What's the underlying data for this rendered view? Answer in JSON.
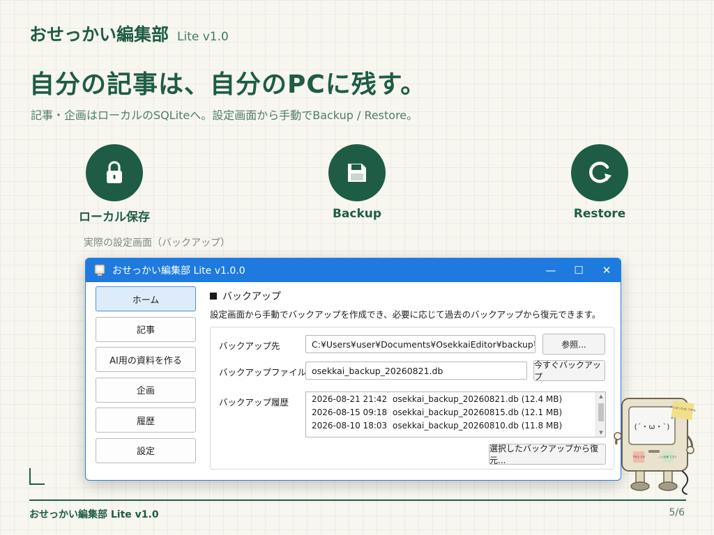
{
  "slide": {
    "brand_name": "おせっかい編集部",
    "brand_version": "Lite v1.0",
    "headline": "自分の記事は、自分のPCに残す。",
    "subtitle": "記事・企画はローカルのSQLiteへ。設定画面から手動でBackup / Restore。",
    "features": [
      {
        "label": "ローカル保存",
        "icon": "lock-icon"
      },
      {
        "label": "Backup",
        "icon": "save-icon"
      },
      {
        "label": "Restore",
        "icon": "restore-icon"
      }
    ],
    "caption": "実際の設定画面（バックアップ）",
    "footer_name": "おせっかい編集部 Lite v1.0",
    "page_number": "5/6"
  },
  "window": {
    "title": "おせっかい編集部 Lite v1.0.0",
    "controls": {
      "minimize": "—",
      "maximize": "☐",
      "close": "✕"
    },
    "sidebar": [
      {
        "label": "ホーム",
        "active": true
      },
      {
        "label": "記事",
        "active": false
      },
      {
        "label": "AI用の資料を作る",
        "active": false
      },
      {
        "label": "企画",
        "active": false
      },
      {
        "label": "履歴",
        "active": false
      },
      {
        "label": "設定",
        "active": false
      }
    ],
    "section_title": "バックアップ",
    "section_desc": "設定画面から手動でバックアップを作成でき、必要に応じて過去のバックアップから復元できます。",
    "backup_dest_label": "バックアップ先",
    "backup_dest_value": "C:¥Users¥user¥Documents¥OsekkaiEditor¥backup¥",
    "browse_button": "参照...",
    "backup_file_label": "バックアップファイル名",
    "backup_file_value": "osekkai_backup_20260821.db",
    "backup_now_button": "今すぐバックアップ",
    "history_label": "バックアップ履歴",
    "history": [
      {
        "datetime": "2026-08-21 21:42",
        "file": "osekkai_backup_20260821.db",
        "size": "(12.4 MB)"
      },
      {
        "datetime": "2026-08-15 09:18",
        "file": "osekkai_backup_20260815.db",
        "size": "(12.1 MB)"
      },
      {
        "datetime": "2026-08-10 18:03",
        "file": "osekkai_backup_20260810.db",
        "size": "(11.8 MB)"
      }
    ],
    "restore_button": "選択したバックアップから復元..."
  },
  "mascot": {
    "face": "(´・ω・`)",
    "note_top": "がんばったね つぎは",
    "note_left": "下書き 今日",
    "note_right": "いい記事 できた"
  },
  "colors": {
    "accent": "#1e5c45",
    "background": "#f7f6ef",
    "titlebar": "#1f7ae0",
    "active_nav": "#ddebfa"
  }
}
